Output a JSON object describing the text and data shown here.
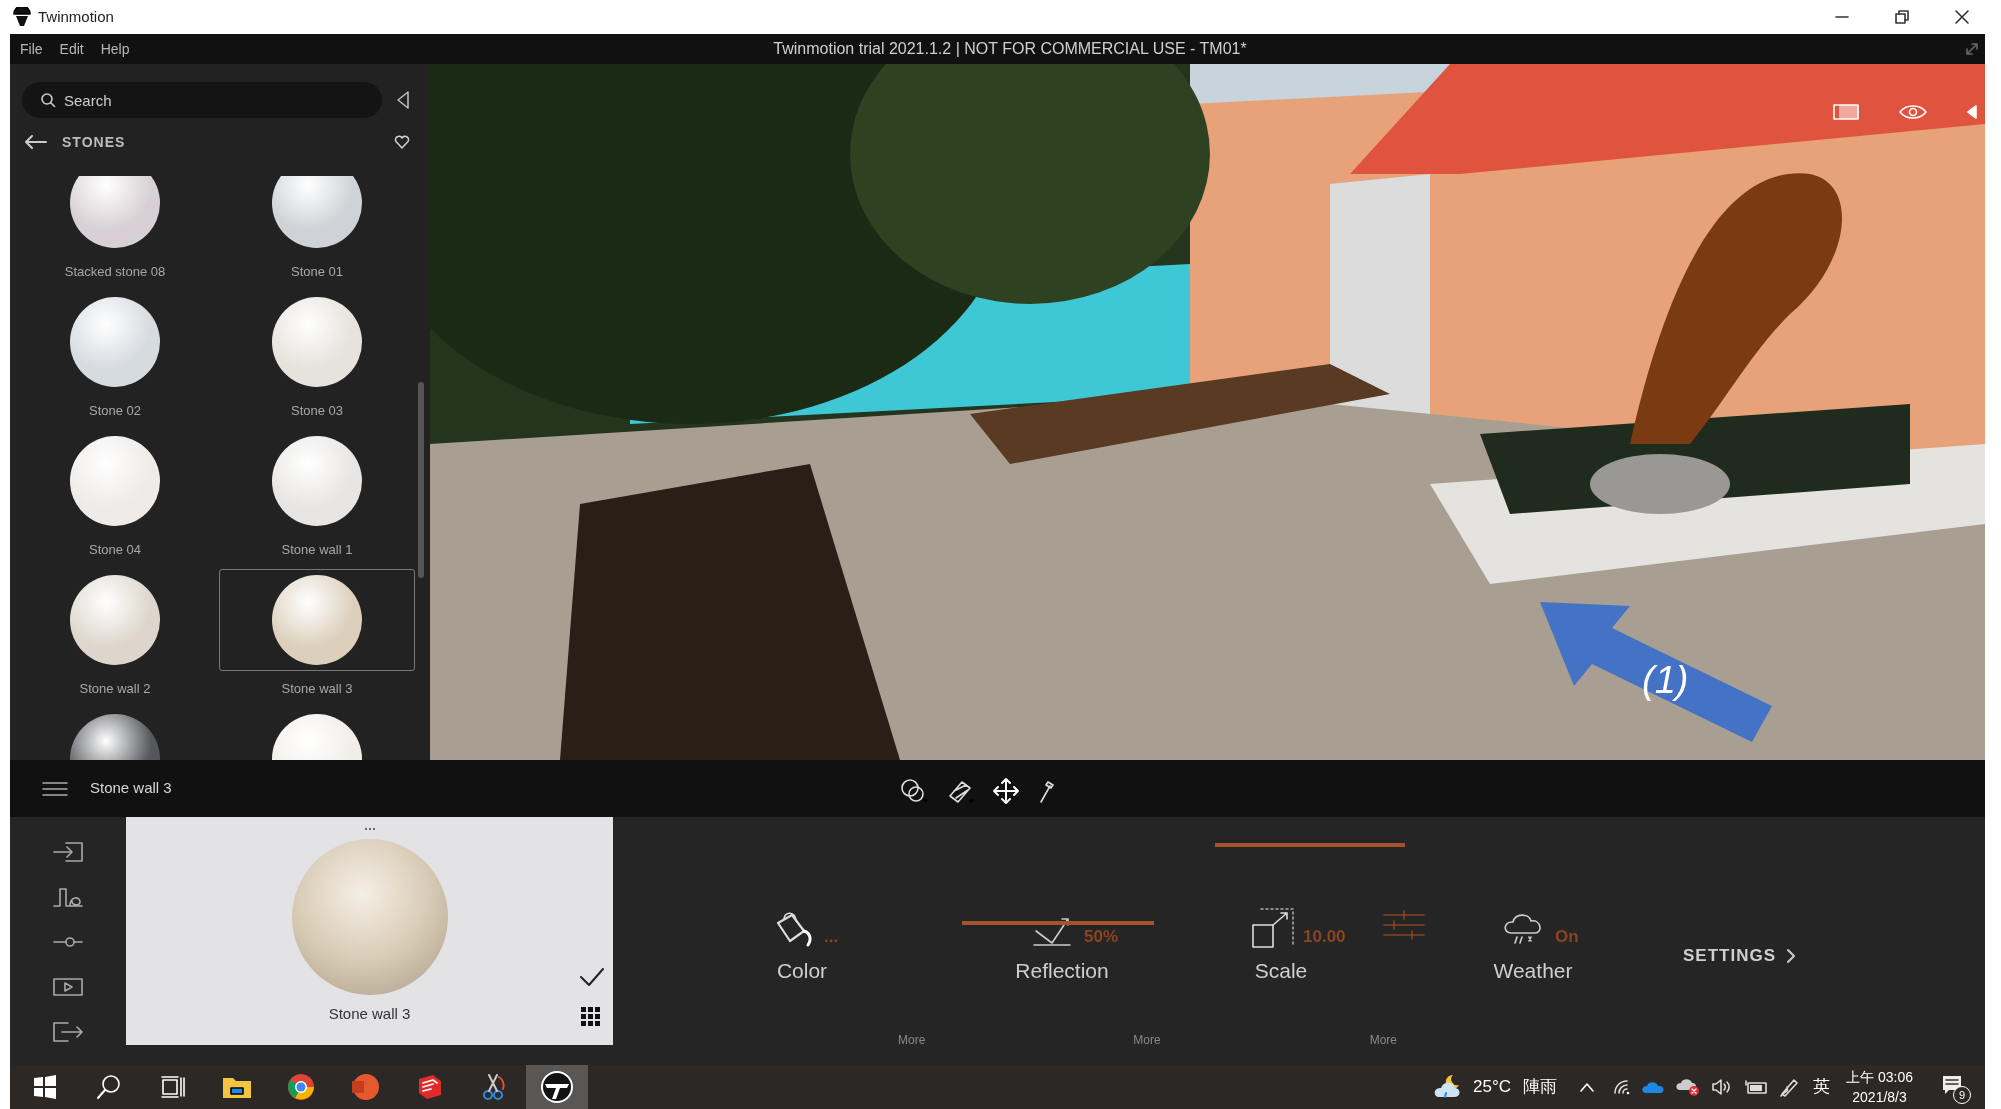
{
  "window": {
    "title": "Twinmotion"
  },
  "menu": [
    "File",
    "Edit",
    "Help"
  ],
  "document_title": "Twinmotion trial 2021.1.2 | NOT FOR COMMERCIAL USE - TM01*",
  "library": {
    "search": {
      "placeholder": "Search"
    },
    "category": "STONES",
    "materials": [
      {
        "name": "Stacked stone 08",
        "color": "#d8d0d4",
        "selected": false
      },
      {
        "name": "Stone 01",
        "color": "#cfd2d6",
        "selected": false
      },
      {
        "name": "Stone 02",
        "color": "#d6dbe0",
        "selected": false
      },
      {
        "name": "Stone 03",
        "color": "#e6e2dc",
        "selected": false
      },
      {
        "name": "Stone 04",
        "color": "#eeebe8",
        "selected": false
      },
      {
        "name": "Stone wall 1",
        "color": "#e8e6e4",
        "selected": false
      },
      {
        "name": "Stone wall 2",
        "color": "#ddd6cc",
        "selected": false
      },
      {
        "name": "Stone wall 3",
        "color": "#dcd0bc",
        "selected": true
      },
      {
        "color": "#55575c",
        "selected": false
      },
      {
        "color": "#f1eee9",
        "selected": false
      }
    ]
  },
  "viewport": {
    "kind": "picture",
    "annotation": "(1)"
  },
  "selection": {
    "name": "Stone wall 3"
  },
  "preview": {
    "name": "Stone wall 3"
  },
  "properties": [
    {
      "kind": "color",
      "label": "Color",
      "value": "...",
      "selected": false
    },
    {
      "kind": "reflection",
      "label": "Reflection",
      "value": "50%",
      "selected": false
    },
    {
      "kind": "scale",
      "label": "Scale",
      "value": "10.00",
      "selected": true
    },
    {
      "kind": "weather",
      "label": "Weather",
      "value": "On",
      "selected": false
    }
  ],
  "more_links": [
    "More",
    "More",
    "More"
  ],
  "settings": "SETTINGS",
  "taskbar": {
    "apps": [
      {
        "kind": "start",
        "selected": false
      },
      {
        "kind": "search",
        "selected": false
      },
      {
        "kind": "taskview",
        "selected": false
      },
      {
        "kind": "folder",
        "selected": false
      },
      {
        "kind": "browser",
        "selected": false
      },
      {
        "kind": "slides",
        "selected": false
      },
      {
        "kind": "sketch",
        "selected": false
      },
      {
        "kind": "snip",
        "selected": false
      },
      {
        "kind": "twinmotion",
        "selected": true
      }
    ],
    "temperature": "25°C",
    "weather": "陣雨",
    "input": "英",
    "time": "上午 03:06",
    "date": "2021/8/3",
    "notifications": "9"
  }
}
